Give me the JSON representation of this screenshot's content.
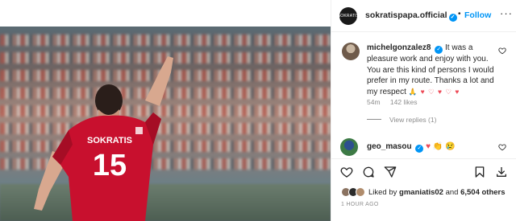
{
  "post": {
    "username": "sokratispapa.official",
    "follow_label": "Follow",
    "dot": "•",
    "more_label": "···",
    "avatar_text": "SOKRATIS",
    "image": {
      "jersey_name": "SOKRATIS",
      "jersey_number": "15"
    }
  },
  "comments": [
    {
      "username": "michelgonzalez8",
      "text": "It was a pleasure work and enjoy with you. You are this kind of persons I would prefer in my route. Thanks a lot and my respect",
      "emoji": "🙏 ♥ ♡ ♥ ♡ ♥",
      "time": "54m",
      "likes": "142 likes",
      "view_replies": "View replies (1)"
    },
    {
      "username": "geo_masou",
      "emoji": "♥ 👏 😢"
    }
  ],
  "likes": {
    "prefix": "Liked by",
    "user": "gmaniatis02",
    "middle": "and",
    "count": "6,504 others"
  },
  "timestamp": "1 HOUR AGO",
  "colors": {
    "accent": "#0095f6",
    "red": "#ed4956",
    "text": "#262626",
    "muted": "#8e8e8e",
    "jersey": "#c8102e"
  },
  "icons": [
    "verified-icon",
    "more-icon",
    "heart-icon",
    "comment-icon",
    "share-icon",
    "bookmark-icon",
    "download-icon"
  ]
}
